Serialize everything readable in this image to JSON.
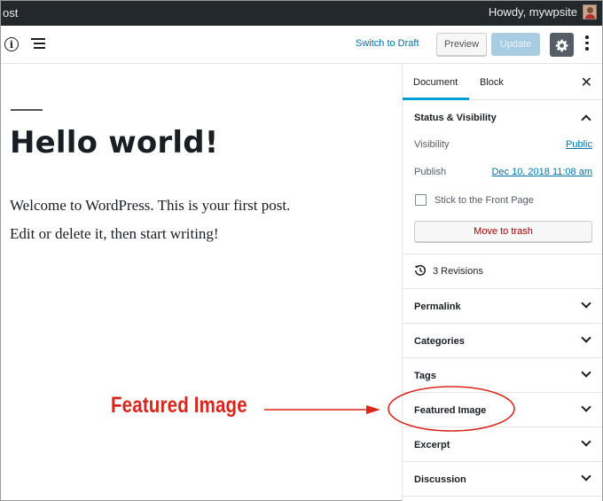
{
  "admin_bar": {
    "left_text": "ost",
    "greeting": "Howdy, mywpsite"
  },
  "header": {
    "switch_to_draft": "Switch to Draft",
    "preview": "Preview",
    "update": "Update"
  },
  "post": {
    "title": "Hello world!",
    "paragraphs": [
      "Welcome to WordPress. This is your first post.",
      "Edit or delete it, then start writing!"
    ]
  },
  "sidebar": {
    "tabs": [
      "Document",
      "Block"
    ],
    "close_glyph": "✕",
    "status_visibility": {
      "title": "Status & Visibility",
      "visibility_label": "Visibility",
      "visibility_value": "Public",
      "publish_label": "Publish",
      "publish_value": "Dec 10, 2018 11:08 am",
      "stick_label": "Stick to the Front Page",
      "trash_label": "Move to trash"
    },
    "revisions_label": "3 Revisions",
    "panels": [
      "Permalink",
      "Categories",
      "Tags",
      "Featured Image",
      "Excerpt",
      "Discussion"
    ]
  },
  "annotation": {
    "text": "Featured Image",
    "color": "#d9261c"
  },
  "colors": {
    "admin_bar": "#23282d",
    "link": "#0073aa",
    "accent_tab": "#00a0d2",
    "trash": "#aa0000"
  }
}
